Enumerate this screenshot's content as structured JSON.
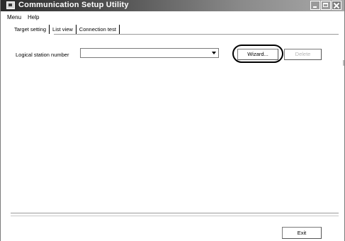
{
  "window": {
    "title": "Communication Setup Utility",
    "buttons": [
      "minimize",
      "maximize",
      "close"
    ]
  },
  "menu": {
    "items": [
      "Menu",
      "Help"
    ]
  },
  "tabs": [
    {
      "label": "Target setting",
      "active": true
    },
    {
      "label": "List view",
      "active": false
    },
    {
      "label": "Connection test",
      "active": false
    }
  ],
  "target": {
    "station_label": "Logical station number",
    "station_value": "",
    "wizard_label": "Wizard...",
    "secondary_label": "Delete"
  },
  "footer": {
    "exit_label": "Exit"
  },
  "colors": {
    "title_dark": "#2b2b2b",
    "title_light": "#a9a9a9",
    "highlight_ring": "#000000"
  }
}
